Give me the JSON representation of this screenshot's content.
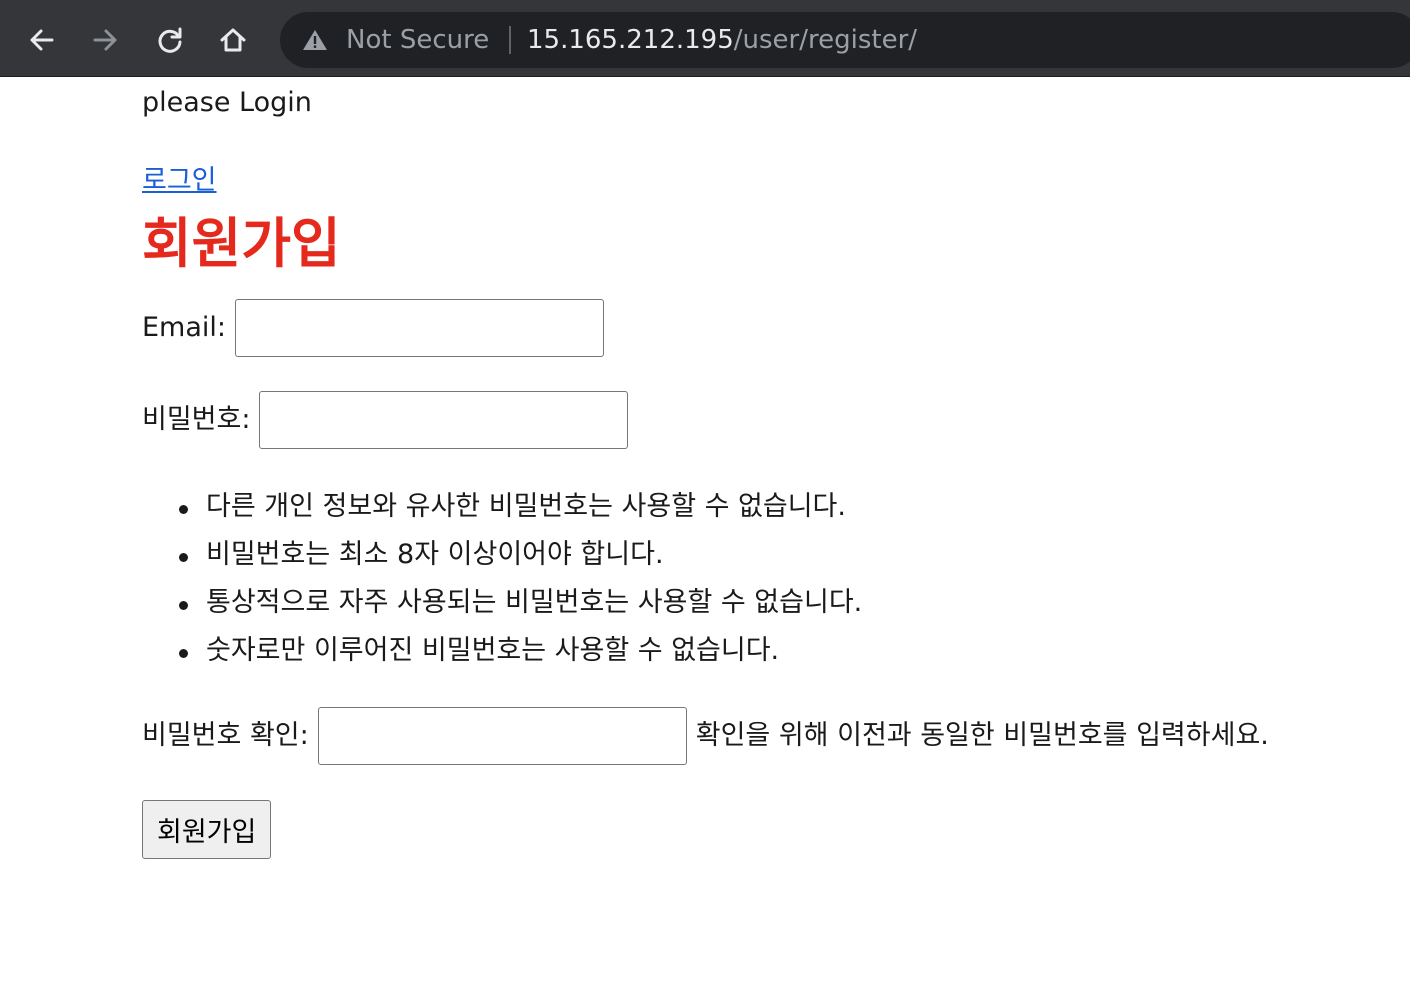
{
  "browser": {
    "security_label": "Not Secure",
    "url_host": "15.165.212.195",
    "url_path": "/user/register/",
    "icons": [
      "back-arrow-icon",
      "forward-arrow-icon",
      "reload-icon",
      "home-icon",
      "warning-triangle-icon"
    ]
  },
  "page": {
    "greeting": "please Login",
    "login_link": "로그인",
    "heading": "회원가입",
    "heading_color": "#e6291d",
    "link_color": "#1a5fd8",
    "form": {
      "email_label": "Email:",
      "email_value": "",
      "password_label": "비밀번호:",
      "password_value": "",
      "password_rules": [
        "다른 개인 정보와 유사한 비밀번호는 사용할 수 없습니다.",
        "비밀번호는 최소 8자 이상이어야 합니다.",
        "통상적으로 자주 사용되는 비밀번호는 사용할 수 없습니다.",
        "숫자로만 이루어진 비밀번호는 사용할 수 없습니다."
      ],
      "confirm_label": "비밀번호 확인:",
      "confirm_value": "",
      "confirm_help": "확인을 위해 이전과 동일한 비밀번호를 입력하세요.",
      "submit_label": "회원가입"
    }
  }
}
